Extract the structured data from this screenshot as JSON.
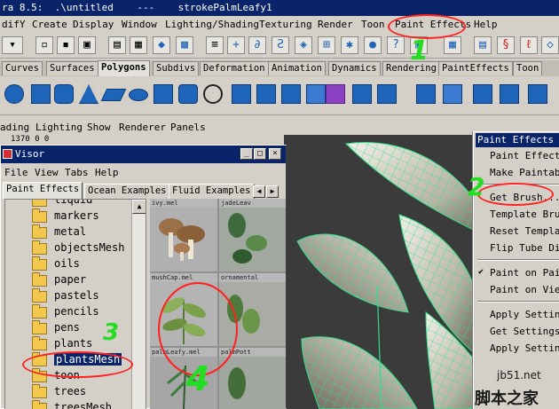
{
  "window": {
    "title": "ra 8.5:  .\\untitled    ---    strokePalmLeafy1"
  },
  "menubar": [
    "difY",
    "Create",
    "Display",
    "Window",
    "Lighting/Shading",
    "Texturing",
    "Render",
    "Toon",
    "Paint Effects",
    "Help"
  ],
  "shelf_tabs": [
    "Curves",
    "Surfaces",
    "Polygons",
    "Subdivs",
    "Deformation",
    "Animation",
    "Dynamics",
    "Rendering",
    "PaintEffects",
    "Toon"
  ],
  "panel_menu": [
    "ading",
    "Lighting",
    "Show",
    "Renderer",
    "Panels"
  ],
  "coord_line": "1370    0    0",
  "visor": {
    "title": "Visor",
    "menu": [
      "File",
      "View",
      "Tabs",
      "Help"
    ],
    "tabs": [
      "Paint Effects",
      "Ocean Examples",
      "Fluid Examples"
    ],
    "folders": [
      "liquid",
      "markers",
      "metal",
      "objectsMesh",
      "oils",
      "paper",
      "pastels",
      "pencils",
      "pens",
      "plants",
      "plantsMesh",
      "toon",
      "trees",
      "treesMesh"
    ],
    "selected_folder": "plantsMesh",
    "thumbnails": [
      "ivy.mel",
      "jadeLeav",
      "mushCap.mel",
      "ornamental",
      "palmLeafy.mel",
      "palmPott"
    ]
  },
  "paint_effects_menu": {
    "title": "Paint Effects",
    "items": [
      "Paint Effects",
      "Make Paintable",
      "Get Brush...",
      "Template Brush",
      "Reset Template",
      "Flip Tube Dir",
      "Paint on Paint",
      "Paint on View",
      "Apply Setting",
      "Get Settings",
      "Apply Setting"
    ],
    "checked": [
      "Paint on Paint"
    ]
  },
  "annotations": [
    "1",
    "2",
    "3",
    "4"
  ],
  "watermark": {
    "site": "jb51.net",
    "name": "脚本之家"
  },
  "colors": {
    "title_bar": "#0a246a",
    "selection": "#0a246a",
    "annotation_red": "#ff2020",
    "annotation_green": "#22dd22"
  }
}
